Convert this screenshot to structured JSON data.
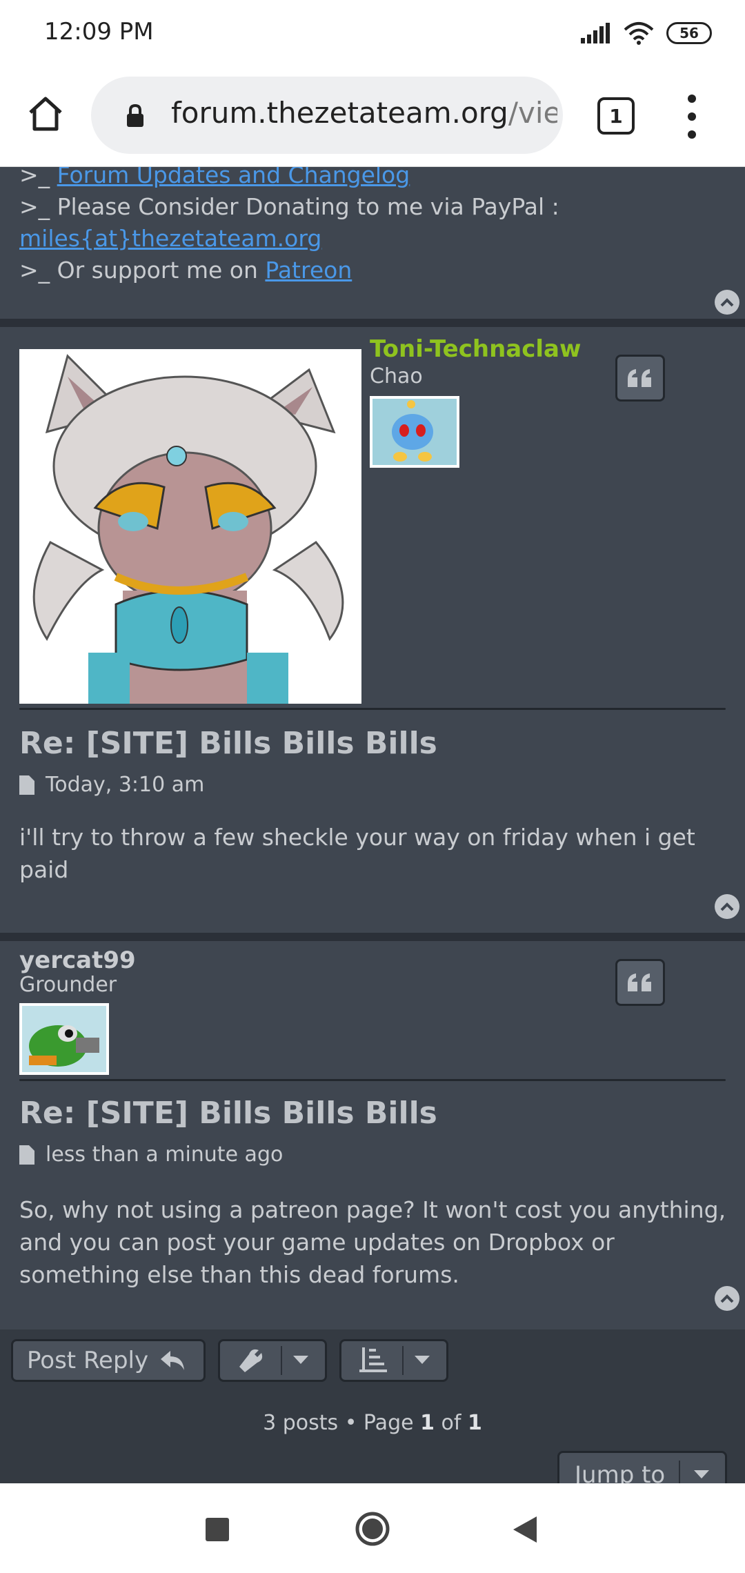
{
  "status_bar": {
    "time": "12:09 PM",
    "battery": "56"
  },
  "browser": {
    "url_domain": "forum.thezetateam.org",
    "url_path": "/viev",
    "tab_count": "1"
  },
  "signature": {
    "line1_prefix": ">_ ",
    "line1_link": "Forum Updates and Changelog",
    "line2": ">_ Please Consider Donating to me via PayPal :",
    "line3_link": "miles{at}thezetateam.org",
    "line4_prefix": ">_ Or support me on ",
    "line4_link": "Patreon"
  },
  "posts": [
    {
      "username": "Toni-Technaclaw",
      "username_color": "#8fc31f",
      "rank": "Chao",
      "title": "Re: [SITE] Bills Bills Bills",
      "time": "Today, 3:10 am",
      "body": "i'll try to throw a few sheckle your way on friday when i get paid"
    },
    {
      "username": "yercat99",
      "username_color": "#c9ccd0",
      "rank": "Grounder",
      "title": "Re: [SITE] Bills Bills Bills",
      "time": "less than a minute ago",
      "body": "So, why not using a patreon page? It won't cost you anything, and you can post your game updates on Dropbox or something else than this dead forums."
    }
  ],
  "actions": {
    "post_reply": "Post Reply",
    "pagination_prefix": "3 posts • Page ",
    "page_current": "1",
    "page_of": " of ",
    "page_total": "1",
    "jump_to": "Jump to"
  },
  "icons": [
    "home-icon",
    "lock-icon",
    "tabs-icon",
    "menu-icon",
    "quote-icon",
    "reply-icon",
    "wrench-icon",
    "sort-icon",
    "chevron-up-icon",
    "file-icon",
    "nav-square-icon",
    "nav-circle-icon",
    "nav-back-icon"
  ]
}
